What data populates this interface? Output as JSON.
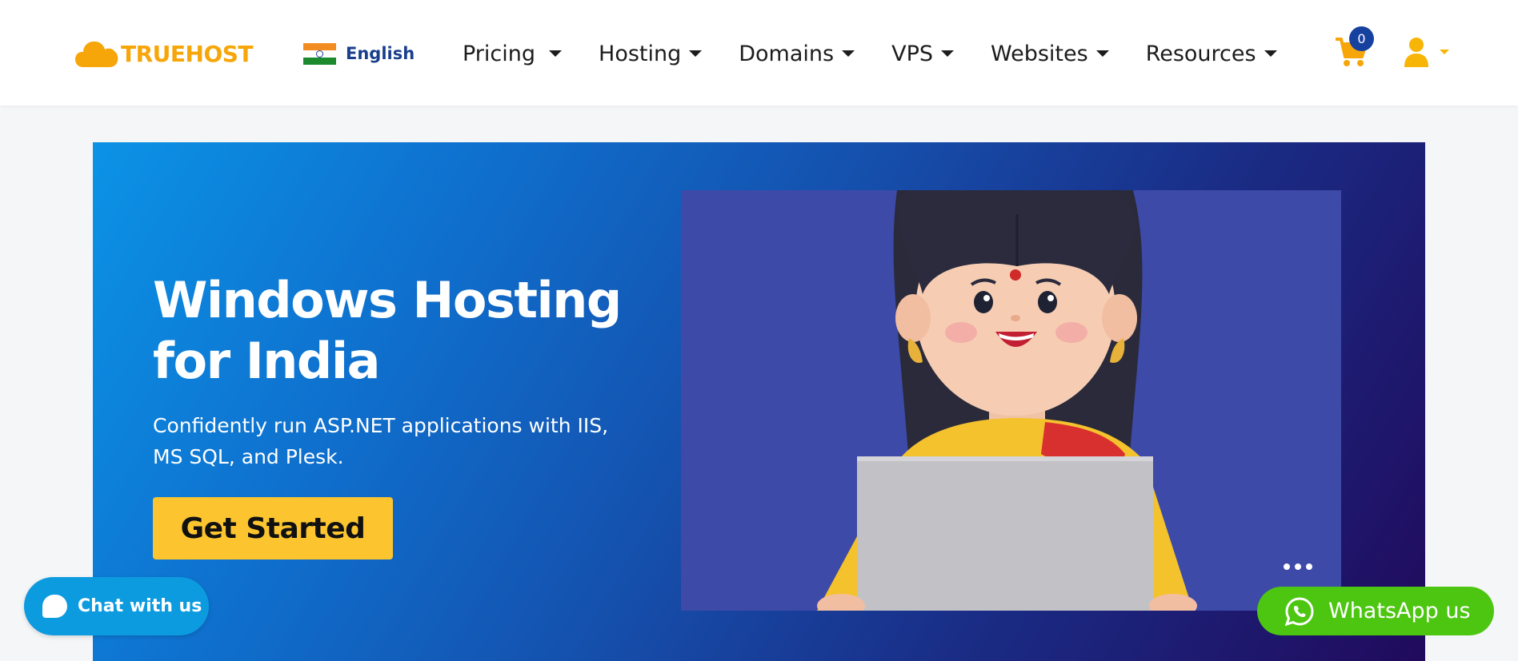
{
  "header": {
    "logo_text": "TRUEHOST",
    "language": "English",
    "nav": [
      "Pricing",
      "Hosting",
      "Domains",
      "VPS",
      "Websites",
      "Resources"
    ],
    "cart_count": "0"
  },
  "hero": {
    "title": "Windows Hosting for India",
    "subtitle": "Confidently run ASP.NET applications with IIS, MS SQL, and Plesk.",
    "cta": "Get Started"
  },
  "chat": {
    "label": "Chat with us"
  },
  "whatsapp": {
    "label": "WhatsApp us"
  },
  "colors": {
    "brand": "#f6a609",
    "hero_start": "#0b93e6",
    "hero_end": "#210a5c",
    "cta": "#fcc52f",
    "badge": "#17419f",
    "whatsapp": "#4cc611",
    "chat": "#0d9be0"
  },
  "icons": [
    "cloud-logo-icon",
    "india-flag-icon",
    "cart-icon",
    "user-icon",
    "chat-bubble-icon",
    "whatsapp-icon",
    "more-dots-icon"
  ]
}
